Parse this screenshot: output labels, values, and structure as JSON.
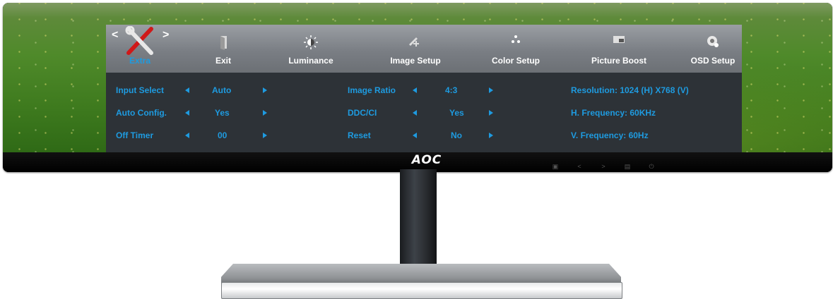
{
  "brand": "AOC",
  "osd": {
    "tabs": [
      {
        "label": "Extra",
        "icon": "tools-icon",
        "active": true
      },
      {
        "label": "Exit",
        "icon": "exit-icon"
      },
      {
        "label": "Luminance",
        "icon": "sun-icon"
      },
      {
        "label": "Image Setup",
        "icon": "image-setup-icon"
      },
      {
        "label": "Color Setup",
        "icon": "color-dots-icon"
      },
      {
        "label": "Picture Boost",
        "icon": "picture-boost-icon"
      },
      {
        "label": "OSD Setup",
        "icon": "osd-setup-icon"
      }
    ],
    "nav_prev": "<",
    "nav_next": ">",
    "rows": [
      {
        "label": "Input Select",
        "value": "Auto"
      },
      {
        "label": "Auto Config.",
        "value": "Yes"
      },
      {
        "label": "Off Timer",
        "value": "00"
      }
    ],
    "rows2": [
      {
        "label": "Image Ratio",
        "value": "4:3"
      },
      {
        "label": "DDC/CI",
        "value": "Yes"
      },
      {
        "label": "Reset",
        "value": "No"
      }
    ],
    "info": [
      "Resolution: 1024 (H) X768 (V)",
      "H. Frequency: 60KHz",
      "V. Frequency: 60Hz"
    ]
  },
  "colors": {
    "accent": "#1e9be0",
    "osd_bg": "#2d3237"
  }
}
